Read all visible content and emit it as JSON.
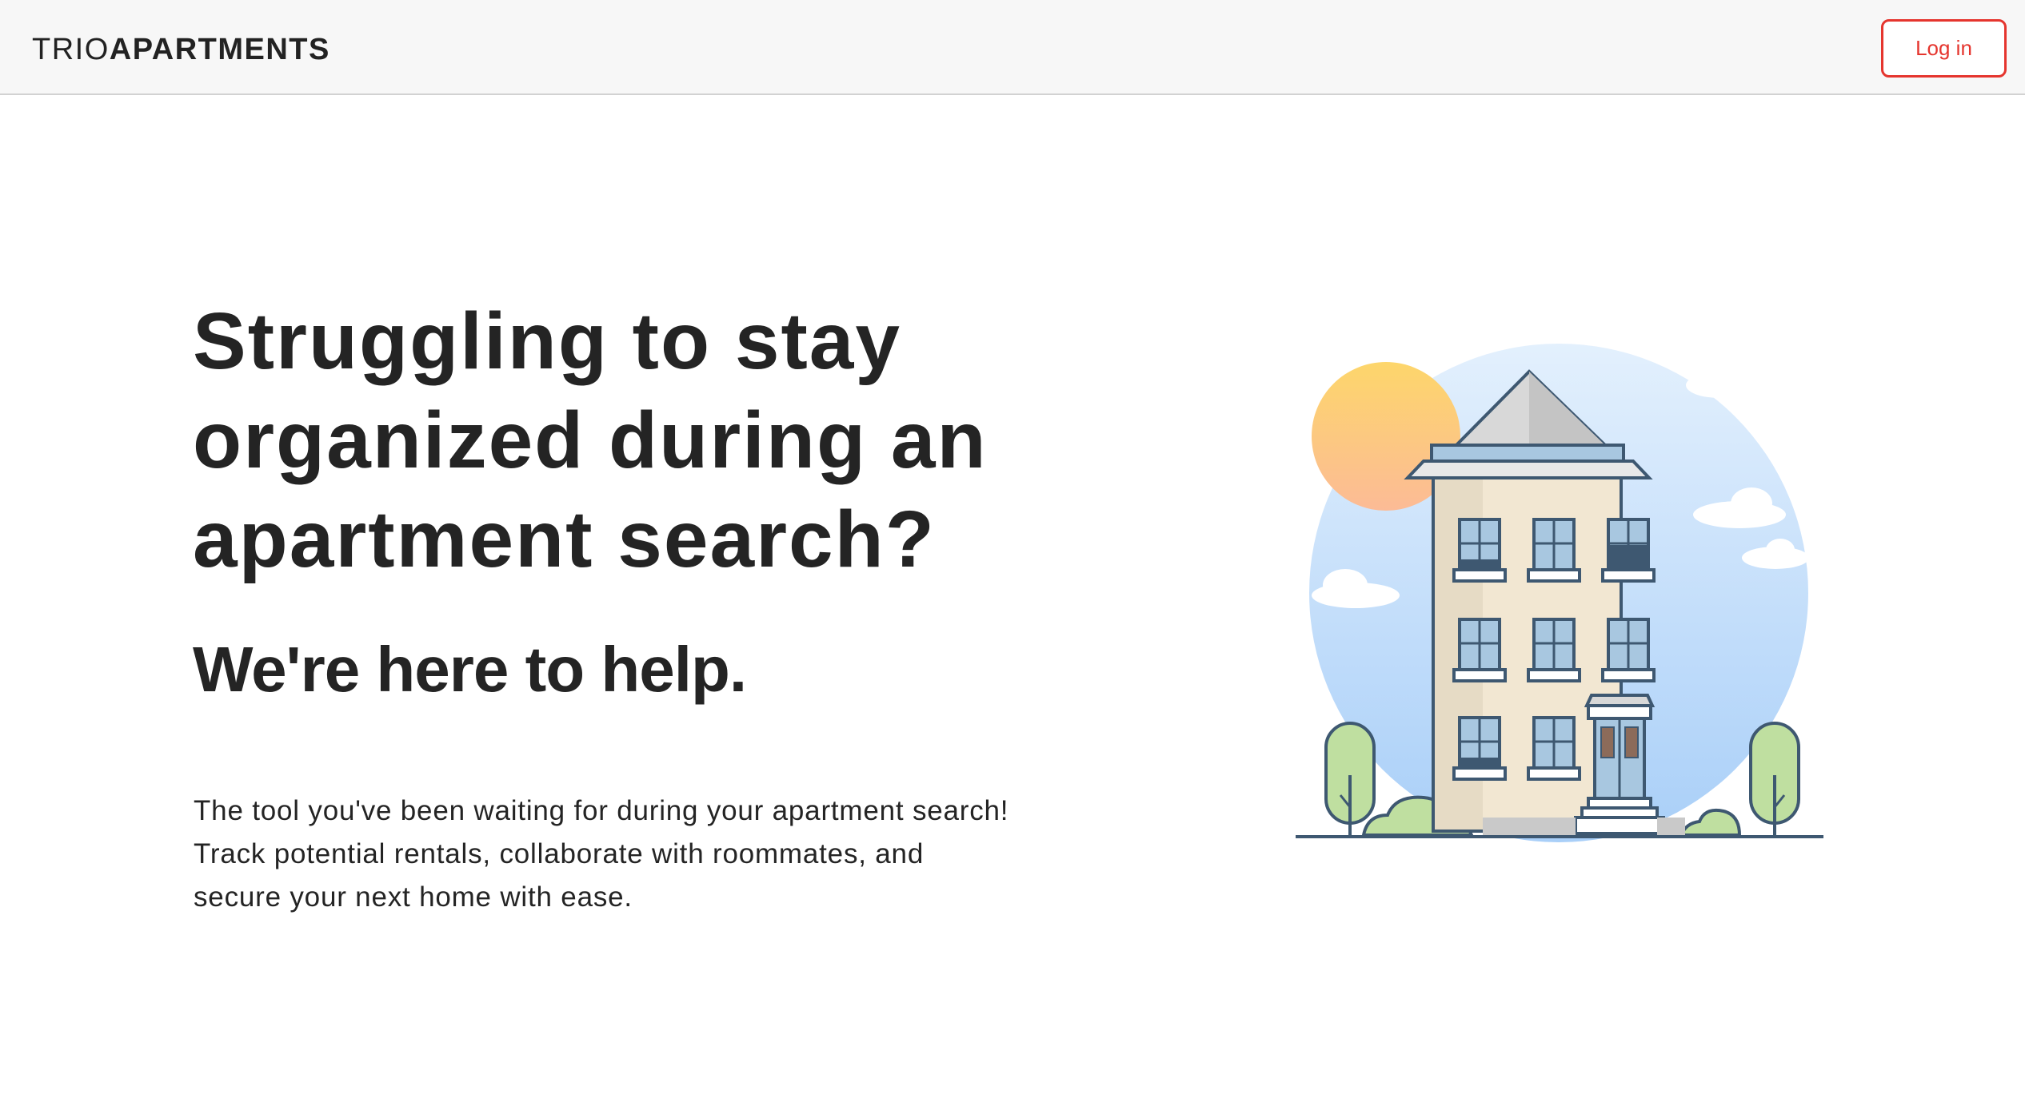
{
  "header": {
    "brand_light": "TRIO",
    "brand_bold": "APARTMENTS",
    "login_label": "Log in",
    "accent_color": "#e5352e"
  },
  "hero": {
    "title": "Struggling to stay organized during an apartment search?",
    "subtitle": "We're here to help.",
    "body": "The tool you've been waiting for during your apartment search! Track potential rentals, collaborate with roommates, and secure your next home with ease."
  },
  "illustration": {
    "icon": "apartment-building-illustration"
  }
}
